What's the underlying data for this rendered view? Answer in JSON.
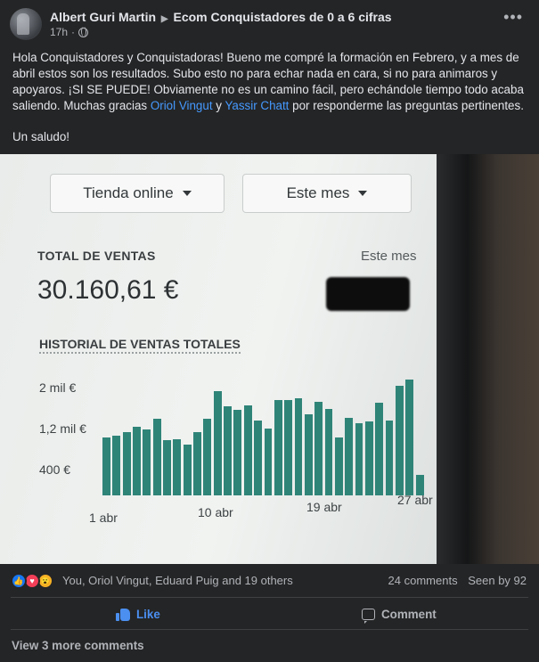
{
  "post": {
    "author": "Albert Guri Martin",
    "group": "Ecom Conquistadores de 0 a 6 cifras",
    "time": "17h",
    "separator": "·",
    "more_label": "•••",
    "body_1": "Hola Conquistadores y Conquistadoras! Bueno me compré la formación en Febrero, y a mes de abril estos son los resultados. Subo esto no para echar nada en cara, si no para animaros y apoyaros. ¡SI SE PUEDE! Obviamente no es un camino fácil, pero echándole tiempo todo acaba saliendo. Muchas gracias ",
    "mention_1": "Oriol Vingut",
    "body_2": " y ",
    "mention_2": "Yassir Chatt",
    "body_3": " por responderme las preguntas pertinentes.",
    "greeting": "Un saludo!"
  },
  "photo": {
    "dropdown_store": "Tienda online",
    "dropdown_period": "Este mes",
    "total_label": "TOTAL DE VENTAS",
    "period_label": "Este mes",
    "total_value": "30.160,61 €",
    "history_label": "HISTORIAL DE VENTAS TOTALES"
  },
  "chart_data": {
    "type": "bar",
    "title": "HISTORIAL DE VENTAS TOTALES",
    "ytick_labels": [
      "2 mil €",
      "1,2 mil €",
      "400 €"
    ],
    "xtick_labels": [
      "1 abr",
      "10 abr",
      "19 abr",
      "27 abr"
    ],
    "ylim": [
      0,
      2200
    ],
    "values": [
      1000,
      1030,
      1100,
      1180,
      1140,
      1320,
      960,
      970,
      870,
      1100,
      1320,
      1800,
      1540,
      1480,
      1560,
      1300,
      1150,
      1650,
      1650,
      1670,
      1400,
      1620,
      1500,
      1000,
      1340,
      1250,
      1280,
      1600,
      1300,
      1900,
      2000,
      350
    ],
    "color": "#2f8478"
  },
  "reactions": {
    "names": "You, Oriol Vingut, Eduard Puig and 19 others",
    "comments": "24 comments",
    "seen": "Seen by 92",
    "like_emoji": "👍",
    "love_emoji": "♥",
    "wow_emoji": "😮"
  },
  "actions": {
    "like_label": "Like",
    "comment_label": "Comment",
    "view_more": "View 3 more comments"
  }
}
